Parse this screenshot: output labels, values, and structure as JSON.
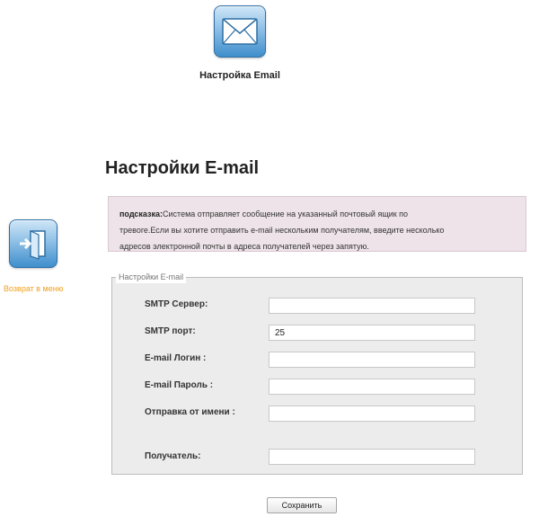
{
  "header": {
    "icon_name": "envelope-icon",
    "label": "Настройка Email"
  },
  "back": {
    "icon_name": "exit-door-icon",
    "label": "Возврат в меню",
    "color": "#f0a020"
  },
  "page": {
    "title": "Настройки E-mail"
  },
  "hint": {
    "label": "подсказка:",
    "line1": "Система отправляет сообщение на указанный почтовый ящик по",
    "line2": "тревоге.Если вы хотите отправить e-mail нескольким получателям, введите несколько",
    "line3": "адресов электронной почты в адреса получателей через запятую."
  },
  "form": {
    "legend": "Настройки E-mail",
    "smtp_server_label": "SMTP Сервер:",
    "smtp_server_value": "",
    "smtp_port_label": "SMTP порт:",
    "smtp_port_value": "25",
    "login_label": "E-mail Логин :",
    "login_value": "",
    "password_label": "E-mail Пароль :",
    "password_value": "",
    "sender_label": "Отправка от имени :",
    "sender_value": "",
    "recipient_label": "Получатель:",
    "recipient_value": ""
  },
  "actions": {
    "save_label": "Сохранить"
  },
  "colors": {
    "hint_bg": "#ede3e8",
    "form_bg": "#ececec",
    "icon_blue": "#3f8fcc"
  }
}
